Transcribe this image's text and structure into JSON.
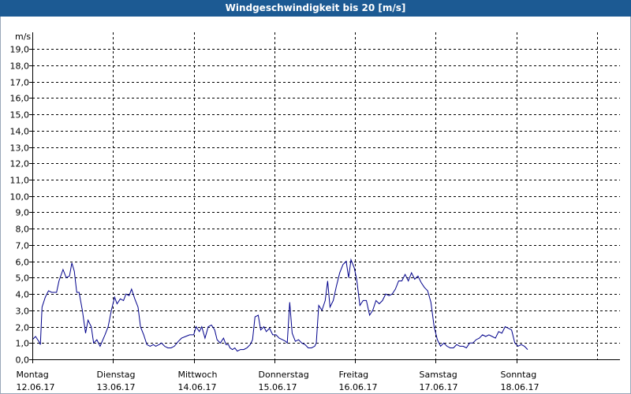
{
  "window": {
    "title": "Windgeschwindigkeit bis 20 [m/s]"
  },
  "chart_data": {
    "type": "line",
    "title": "Windgeschwindigkeit bis 20 [m/s]",
    "ylabel": "m/s",
    "ylim": [
      0,
      20
    ],
    "yticks": [
      "0,0",
      "1,0",
      "2,0",
      "3,0",
      "4,0",
      "5,0",
      "6,0",
      "7,0",
      "8,0",
      "9,0",
      "10,0",
      "11,0",
      "12,0",
      "13,0",
      "14,0",
      "15,0",
      "16,0",
      "17,0",
      "18,0",
      "19,0"
    ],
    "xlim": [
      0,
      7
    ],
    "grid": true,
    "line_color": "#00008b",
    "days": [
      {
        "name": "Montag",
        "date": "12.06.17"
      },
      {
        "name": "Dienstag",
        "date": "13.06.17"
      },
      {
        "name": "Mittwoch",
        "date": "14.06.17"
      },
      {
        "name": "Donnerstag",
        "date": "15.06.17"
      },
      {
        "name": "Freitag",
        "date": "16.06.17"
      },
      {
        "name": "Samstag",
        "date": "17.06.17"
      },
      {
        "name": "Sonntag",
        "date": "18.06.17"
      }
    ],
    "series": [
      {
        "points": [
          [
            0.0,
            1.2
          ],
          [
            0.04,
            1.4
          ],
          [
            0.08,
            1.1
          ],
          [
            0.1,
            0.9
          ],
          [
            0.12,
            3.2
          ],
          [
            0.16,
            3.8
          ],
          [
            0.2,
            4.2
          ],
          [
            0.24,
            4.1
          ],
          [
            0.3,
            4.1
          ],
          [
            0.33,
            4.8
          ],
          [
            0.38,
            5.5
          ],
          [
            0.42,
            5.0
          ],
          [
            0.46,
            5.1
          ],
          [
            0.49,
            5.9
          ],
          [
            0.52,
            5.4
          ],
          [
            0.55,
            4.1
          ],
          [
            0.58,
            4.1
          ],
          [
            0.62,
            3.0
          ],
          [
            0.66,
            1.6
          ],
          [
            0.69,
            2.4
          ],
          [
            0.73,
            2.0
          ],
          [
            0.76,
            1.0
          ],
          [
            0.8,
            1.2
          ],
          [
            0.84,
            0.8
          ],
          [
            0.9,
            1.5
          ],
          [
            0.94,
            2.0
          ],
          [
            0.98,
            3.0
          ],
          [
            1.02,
            3.8
          ],
          [
            1.05,
            3.4
          ],
          [
            1.09,
            3.7
          ],
          [
            1.13,
            3.6
          ],
          [
            1.16,
            4.0
          ],
          [
            1.2,
            3.9
          ],
          [
            1.23,
            4.3
          ],
          [
            1.27,
            3.7
          ],
          [
            1.31,
            3.2
          ],
          [
            1.34,
            2.0
          ],
          [
            1.38,
            1.5
          ],
          [
            1.42,
            0.9
          ],
          [
            1.46,
            0.8
          ],
          [
            1.5,
            0.9
          ],
          [
            1.53,
            0.8
          ],
          [
            1.57,
            0.9
          ],
          [
            1.6,
            1.0
          ],
          [
            1.64,
            0.8
          ],
          [
            1.68,
            0.7
          ],
          [
            1.72,
            0.7
          ],
          [
            1.76,
            0.8
          ],
          [
            1.81,
            1.1
          ],
          [
            1.85,
            1.3
          ],
          [
            1.9,
            1.4
          ],
          [
            1.95,
            1.5
          ],
          [
            2.0,
            1.5
          ],
          [
            2.03,
            2.0
          ],
          [
            2.07,
            1.7
          ],
          [
            2.1,
            2.0
          ],
          [
            2.14,
            1.3
          ],
          [
            2.18,
            2.0
          ],
          [
            2.22,
            2.1
          ],
          [
            2.26,
            1.8
          ],
          [
            2.29,
            1.2
          ],
          [
            2.33,
            1.0
          ],
          [
            2.37,
            1.3
          ],
          [
            2.4,
            0.9
          ],
          [
            2.43,
            0.9
          ],
          [
            2.45,
            0.7
          ],
          [
            2.48,
            0.6
          ],
          [
            2.51,
            0.7
          ],
          [
            2.54,
            0.5
          ],
          [
            2.58,
            0.6
          ],
          [
            2.62,
            0.6
          ],
          [
            2.66,
            0.7
          ],
          [
            2.7,
            0.9
          ],
          [
            2.73,
            1.2
          ],
          [
            2.76,
            2.6
          ],
          [
            2.8,
            2.7
          ],
          [
            2.83,
            1.8
          ],
          [
            2.87,
            2.0
          ],
          [
            2.9,
            1.7
          ],
          [
            2.94,
            1.9
          ],
          [
            2.98,
            1.5
          ],
          [
            3.02,
            1.5
          ],
          [
            3.06,
            1.3
          ],
          [
            3.1,
            1.2
          ],
          [
            3.14,
            1.1
          ],
          [
            3.16,
            1.0
          ],
          [
            3.19,
            3.5
          ],
          [
            3.22,
            1.6
          ],
          [
            3.26,
            1.1
          ],
          [
            3.3,
            1.2
          ],
          [
            3.34,
            1.0
          ],
          [
            3.38,
            0.9
          ],
          [
            3.42,
            0.7
          ],
          [
            3.46,
            0.7
          ],
          [
            3.5,
            0.8
          ],
          [
            3.52,
            1.0
          ],
          [
            3.55,
            3.3
          ],
          [
            3.59,
            3.0
          ],
          [
            3.63,
            3.6
          ],
          [
            3.66,
            4.8
          ],
          [
            3.69,
            3.2
          ],
          [
            3.73,
            3.6
          ],
          [
            3.77,
            4.5
          ],
          [
            3.81,
            5.3
          ],
          [
            3.85,
            5.8
          ],
          [
            3.89,
            6.0
          ],
          [
            3.92,
            5.0
          ],
          [
            3.95,
            6.1
          ],
          [
            3.99,
            5.6
          ],
          [
            4.02,
            4.9
          ],
          [
            4.06,
            3.3
          ],
          [
            4.1,
            3.6
          ],
          [
            4.14,
            3.6
          ],
          [
            4.18,
            2.7
          ],
          [
            4.22,
            3.0
          ],
          [
            4.26,
            3.6
          ],
          [
            4.3,
            3.4
          ],
          [
            4.34,
            3.6
          ],
          [
            4.38,
            4.0
          ],
          [
            4.42,
            3.9
          ],
          [
            4.46,
            4.0
          ],
          [
            4.5,
            4.3
          ],
          [
            4.54,
            4.8
          ],
          [
            4.58,
            4.8
          ],
          [
            4.62,
            5.2
          ],
          [
            4.66,
            4.8
          ],
          [
            4.7,
            5.3
          ],
          [
            4.74,
            4.9
          ],
          [
            4.78,
            5.1
          ],
          [
            4.82,
            4.7
          ],
          [
            4.86,
            4.4
          ],
          [
            4.9,
            4.2
          ],
          [
            4.94,
            3.5
          ],
          [
            4.98,
            2.0
          ],
          [
            5.02,
            1.2
          ],
          [
            5.06,
            0.8
          ],
          [
            5.1,
            1.0
          ],
          [
            5.14,
            0.8
          ],
          [
            5.18,
            0.7
          ],
          [
            5.22,
            0.7
          ],
          [
            5.26,
            0.9
          ],
          [
            5.3,
            0.8
          ],
          [
            5.34,
            0.8
          ],
          [
            5.38,
            0.7
          ],
          [
            5.42,
            1.0
          ],
          [
            5.46,
            1.0
          ],
          [
            5.5,
            1.2
          ],
          [
            5.54,
            1.3
          ],
          [
            5.58,
            1.5
          ],
          [
            5.62,
            1.4
          ],
          [
            5.66,
            1.5
          ],
          [
            5.7,
            1.4
          ],
          [
            5.74,
            1.3
          ],
          [
            5.78,
            1.7
          ],
          [
            5.82,
            1.6
          ],
          [
            5.86,
            2.0
          ],
          [
            5.9,
            1.9
          ],
          [
            5.94,
            1.8
          ],
          [
            5.98,
            1.0
          ],
          [
            6.02,
            0.8
          ],
          [
            6.06,
            0.9
          ],
          [
            6.1,
            0.8
          ],
          [
            6.14,
            0.6
          ]
        ]
      }
    ]
  }
}
